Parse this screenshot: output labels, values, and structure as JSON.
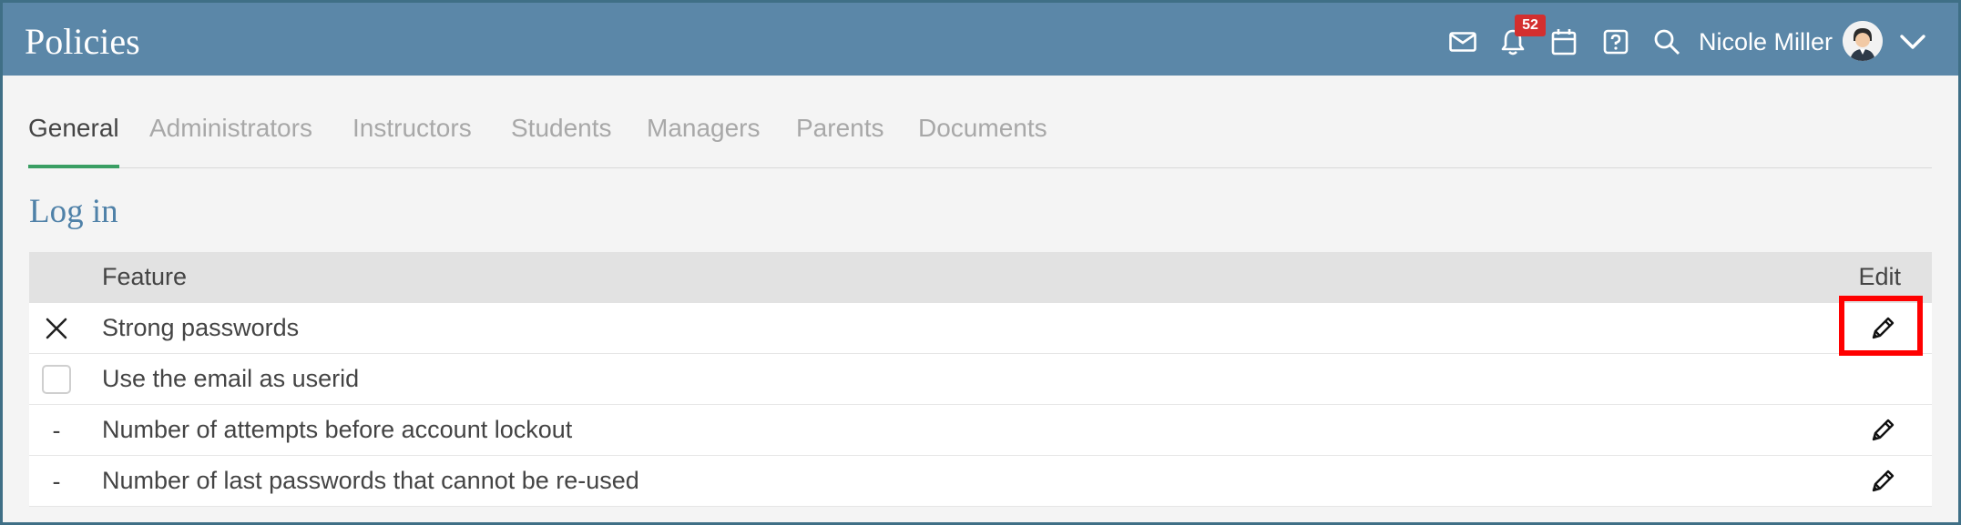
{
  "header": {
    "title": "Policies",
    "notification_count": "52",
    "user_name": "Nicole Miller",
    "icons": [
      "mail-icon",
      "bell-icon",
      "calendar-icon",
      "help-icon",
      "search-icon",
      "chevron-down-icon"
    ]
  },
  "tabs": [
    {
      "label": "General",
      "active": true
    },
    {
      "label": "Administrators",
      "active": false
    },
    {
      "label": "Instructors",
      "active": false
    },
    {
      "label": "Students",
      "active": false
    },
    {
      "label": "Managers",
      "active": false
    },
    {
      "label": "Parents",
      "active": false
    },
    {
      "label": "Documents",
      "active": false
    }
  ],
  "section": {
    "title": "Log in"
  },
  "table": {
    "headers": {
      "feature": "Feature",
      "edit": "Edit"
    },
    "rows": [
      {
        "status": "x",
        "label": "Strong passwords",
        "editable": true
      },
      {
        "status": "checkbox",
        "label": "Use the email as userid",
        "editable": false
      },
      {
        "status": "-",
        "label": "Number of attempts before account lockout",
        "editable": true
      },
      {
        "status": "-",
        "label": "Number of last passwords that cannot be re-used",
        "editable": true
      }
    ]
  },
  "colors": {
    "header_bg": "#5b87a8",
    "active_tab_underline": "#3a9e63",
    "section_title": "#4f81a8",
    "badge": "#d32f2f",
    "highlight": "#ff0000"
  }
}
